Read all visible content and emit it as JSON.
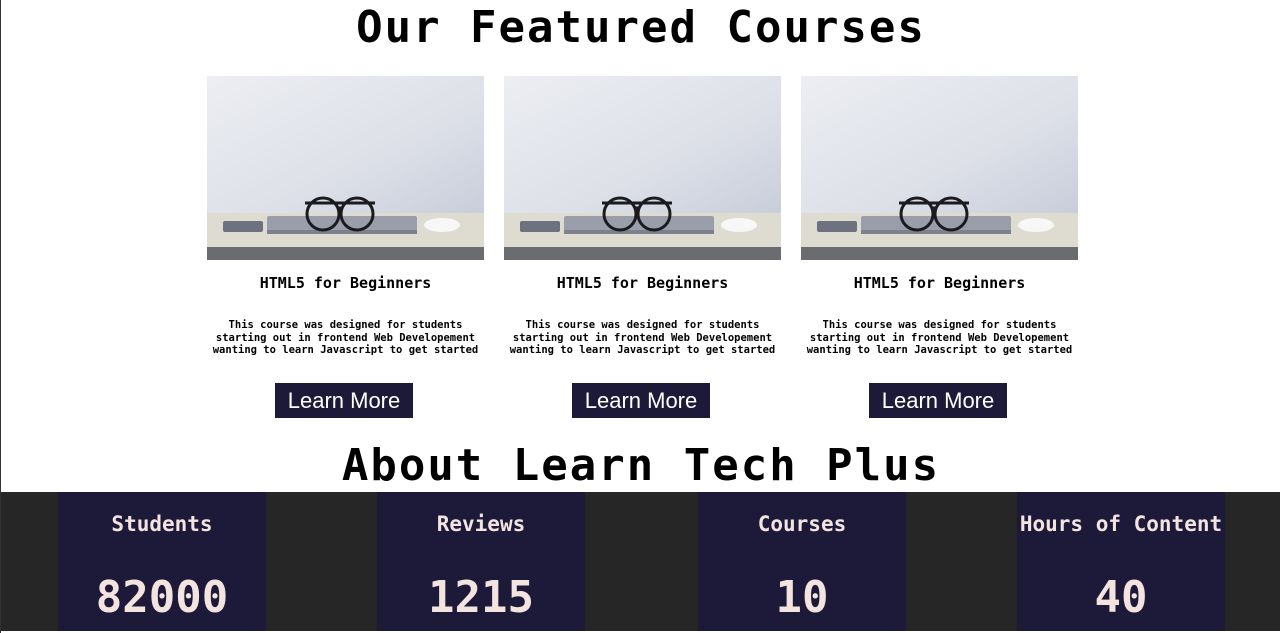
{
  "featured": {
    "title": "Our Featured Courses",
    "courses": [
      {
        "image_icon": "desk-glasses-laptop-image",
        "title": "HTML5 for Beginners",
        "description": "This course was designed for students starting out in frontend Web Developement wanting to learn Javascript to get started",
        "button_label": "Learn More"
      },
      {
        "image_icon": "desk-glasses-laptop-image",
        "title": "HTML5 for Beginners",
        "description": "This course was designed for students starting out in frontend Web Developement wanting to learn Javascript to get started",
        "button_label": "Learn More"
      },
      {
        "image_icon": "desk-glasses-laptop-image",
        "title": "HTML5 for Beginners",
        "description": "This course was designed for students starting out in frontend Web Developement wanting to learn Javascript to get started",
        "button_label": "Learn More"
      }
    ]
  },
  "about": {
    "title": "About Learn Tech Plus",
    "stats": [
      {
        "label": "Students",
        "value": "82000"
      },
      {
        "label": "Reviews",
        "value": "1215"
      },
      {
        "label": "Courses",
        "value": "10"
      },
      {
        "label": "Hours of Content",
        "value": "40"
      }
    ]
  },
  "colors": {
    "button_bg": "#1c1a38",
    "stat_bg": "#1c1a38",
    "band_bg": "#262626",
    "stat_text": "#f4e4e0"
  }
}
